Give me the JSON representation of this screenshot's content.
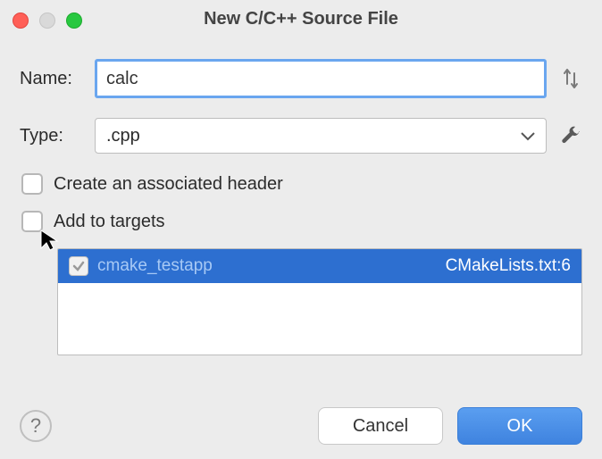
{
  "window": {
    "title": "New C/C++ Source File"
  },
  "form": {
    "name_label": "Name:",
    "name_value": "calc",
    "type_label": "Type:",
    "type_value": ".cpp"
  },
  "checkboxes": {
    "create_header_label": "Create an associated header",
    "add_targets_label": "Add to targets"
  },
  "targets": {
    "items": [
      {
        "name": "cmake_testapp",
        "file": "CMakeLists.txt:6",
        "checked": true
      }
    ]
  },
  "buttons": {
    "cancel": "Cancel",
    "ok": "OK"
  }
}
